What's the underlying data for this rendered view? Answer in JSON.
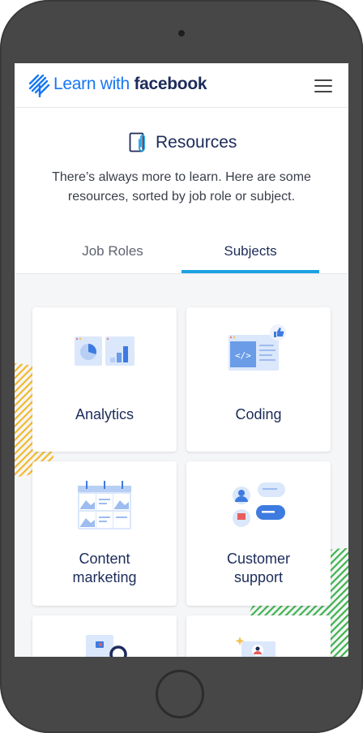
{
  "header": {
    "brand_prefix": "Learn with ",
    "brand_name": "facebook"
  },
  "intro": {
    "title": "Resources",
    "description": "There’s always more to learn. Here are some resources, sorted by job role or subject."
  },
  "tabs": {
    "job_roles": "Job Roles",
    "subjects": "Subjects",
    "active": "Subjects"
  },
  "cards": [
    {
      "label": "Analytics",
      "icon": "analytics-illustration-icon"
    },
    {
      "label": "Coding",
      "icon": "coding-illustration-icon"
    },
    {
      "label": "Content\nmarketing",
      "icon": "calendar-illustration-icon"
    },
    {
      "label": "Customer\nsupport",
      "icon": "chat-illustration-icon"
    },
    {
      "label": "",
      "icon": "document-search-illustration-icon"
    },
    {
      "label": "",
      "icon": "profile-document-illustration-icon"
    }
  ],
  "colors": {
    "accent_blue": "#1ba1e2",
    "brand_blue": "#1877f2",
    "text_navy": "#1c2b5a",
    "stripe_yellow": "#f2b92b",
    "stripe_green": "#3fb34f"
  }
}
